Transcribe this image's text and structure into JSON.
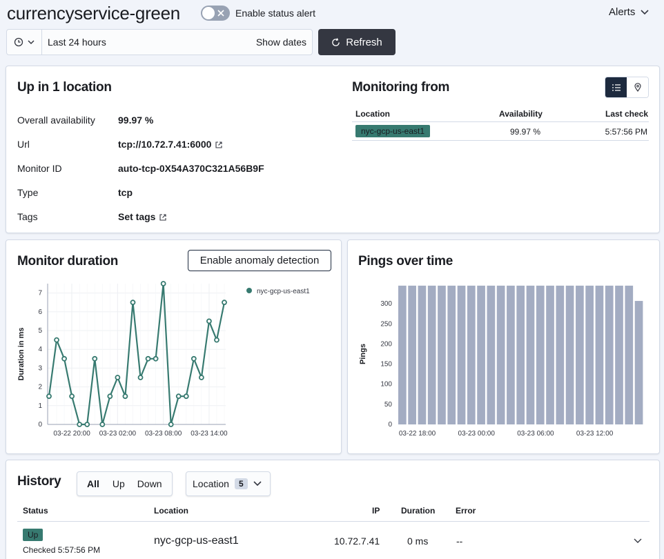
{
  "header": {
    "monitor_name": "currencyservice-green",
    "status_alert_label": "Enable status alert",
    "alerts_label": "Alerts"
  },
  "datepicker": {
    "range": "Last 24 hours",
    "show_dates": "Show dates",
    "refresh": "Refresh"
  },
  "status_panel": {
    "title": "Up in 1 location",
    "rows": [
      {
        "label": "Overall availability",
        "value": "99.97 %"
      },
      {
        "label": "Url",
        "value": "tcp://10.72.7.41:6000"
      },
      {
        "label": "Monitor ID",
        "value": "auto-tcp-0X54A370C321A56B9F"
      },
      {
        "label": "Type",
        "value": "tcp"
      },
      {
        "label": "Tags",
        "value": "Set tags"
      }
    ],
    "monitoring_title": "Monitoring from",
    "table_headers": [
      "Location",
      "Availability",
      "Last check"
    ],
    "table_rows": [
      {
        "location": "nyc-gcp-us-east1",
        "availability": "99.97 %",
        "last_check": "5:57:56 PM"
      }
    ]
  },
  "duration_panel": {
    "title": "Monitor duration",
    "anomaly_button": "Enable anomaly detection"
  },
  "pings_panel": {
    "title": "Pings over time"
  },
  "history": {
    "title": "History",
    "filters": [
      "All",
      "Up",
      "Down"
    ],
    "location_label": "Location",
    "location_count": "5",
    "headers": {
      "status": "Status",
      "location": "Location",
      "ip": "IP",
      "duration": "Duration",
      "error": "Error"
    },
    "rows": [
      {
        "status": "Up",
        "checked": "Checked 5:57:56 PM",
        "location": "nyc-gcp-us-east1",
        "ip": "10.72.7.41",
        "duration": "0 ms",
        "error": "--"
      }
    ]
  },
  "colors": {
    "accent": "#377a70",
    "bar": "#a3acc2",
    "dark_button": "#343741"
  },
  "chart_data": [
    {
      "type": "line",
      "title": "",
      "xlabel": "",
      "ylabel": "Duration in ms",
      "ylim": [
        0,
        7.5
      ],
      "yticks": [
        0,
        1,
        2,
        3,
        4,
        5,
        6,
        7
      ],
      "xtick_labels": [
        "03-22 20:00",
        "03-23 02:00",
        "03-23 08:00",
        "03-23 14:00"
      ],
      "xtick_index": [
        3,
        9,
        15,
        21
      ],
      "series": [
        {
          "name": "nyc-gcp-us-east1",
          "color": "#377a70",
          "values": [
            1.5,
            4.5,
            3.5,
            1.5,
            0,
            0,
            3.5,
            0,
            1.5,
            2.5,
            1.5,
            6.5,
            2.5,
            3.5,
            3.5,
            7.5,
            0,
            1.5,
            1.5,
            3.5,
            2.5,
            5.5,
            4.5,
            6.5
          ]
        }
      ]
    },
    {
      "type": "bar",
      "title": "",
      "xlabel": "",
      "ylabel": "Pings",
      "ylim": [
        0,
        350
      ],
      "yticks": [
        0,
        50,
        100,
        150,
        200,
        250,
        300
      ],
      "xtick_labels": [
        "03-22 18:00",
        "03-23 00:00",
        "03-23 06:00",
        "03-23 12:00"
      ],
      "xtick_index": [
        2,
        8,
        14,
        20
      ],
      "values": [
        345,
        345,
        345,
        345,
        345,
        345,
        345,
        345,
        345,
        345,
        345,
        345,
        345,
        345,
        345,
        345,
        345,
        345,
        345,
        345,
        345,
        345,
        345,
        345,
        307
      ]
    }
  ]
}
